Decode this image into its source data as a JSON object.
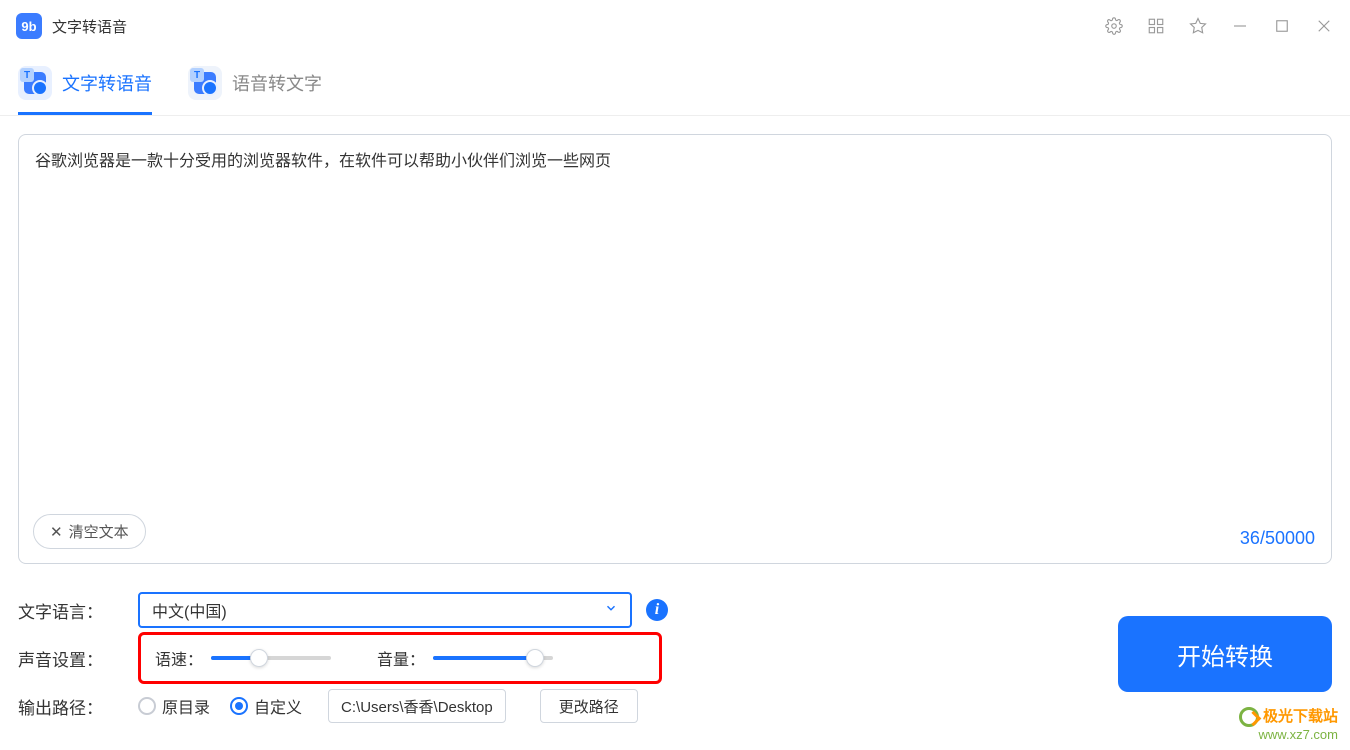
{
  "app": {
    "title": "文字转语音"
  },
  "tabs": {
    "tts": "文字转语音",
    "stt": "语音转文字"
  },
  "editor": {
    "text": "谷歌浏览器是一款十分受用的浏览器软件，在软件可以帮助小伙伴们浏览一些网页",
    "clear": "清空文本",
    "counter": "36/50000"
  },
  "settings": {
    "language_label": "文字语言：",
    "language_value": "中文(中国)",
    "sound_label": "声音设置：",
    "speed_label": "语速：",
    "volume_label": "音量：",
    "speed_pct": 40,
    "volume_pct": 85,
    "output_label": "输出路径：",
    "radio_original": "原目录",
    "radio_custom": "自定义",
    "path_value": "C:\\Users\\香香\\Desktop",
    "change_path": "更改路径"
  },
  "action": {
    "start": "开始转换"
  },
  "watermark": {
    "name": "极光下载站",
    "url": "www.xz7.com"
  }
}
